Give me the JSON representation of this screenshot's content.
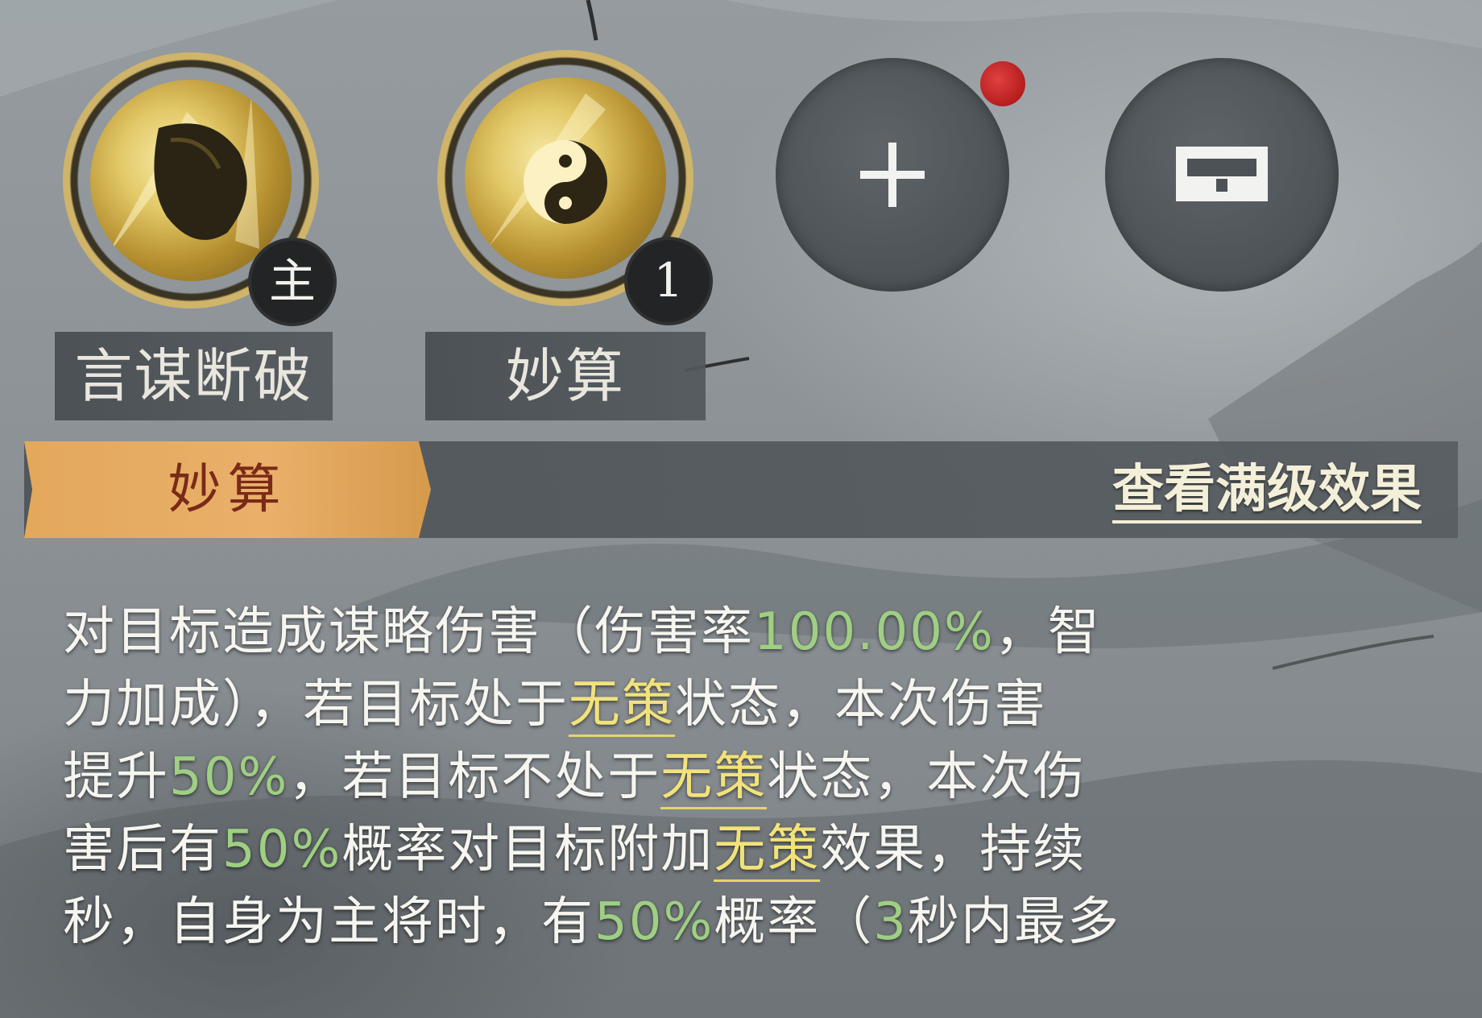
{
  "skills": {
    "slot_main": {
      "name": "言谋断破",
      "badge": "主",
      "icon": "leaf-emblem-icon"
    },
    "slot_1": {
      "name": "妙算",
      "badge": "1",
      "icon": "yin-yang-emblem-icon"
    },
    "slot_add": {
      "icon": "plus-icon",
      "has_notification": true
    },
    "slot_save": {
      "icon": "save-tray-icon"
    }
  },
  "tabbar": {
    "active_tab": "妙算",
    "link_label": "查看满级效果"
  },
  "description": {
    "lines": [
      [
        {
          "t": "对目标造成谋略伤害（伤害率",
          "k": "text"
        },
        {
          "t": "100.00%",
          "k": "num"
        },
        {
          "t": "，智",
          "k": "text"
        }
      ],
      [
        {
          "t": "力加成），若目标处于",
          "k": "text"
        },
        {
          "t": "无策",
          "k": "kw"
        },
        {
          "t": "状态，本次伤害",
          "k": "text"
        }
      ],
      [
        {
          "t": "提升",
          "k": "text"
        },
        {
          "t": "50%",
          "k": "num"
        },
        {
          "t": "，若目标不处于",
          "k": "text"
        },
        {
          "t": "无策",
          "k": "kw"
        },
        {
          "t": "状态，本次伤",
          "k": "text"
        }
      ],
      [
        {
          "t": "害后有",
          "k": "text"
        },
        {
          "t": "50%",
          "k": "num"
        },
        {
          "t": "概率对目标附加",
          "k": "text"
        },
        {
          "t": "无策",
          "k": "kw"
        },
        {
          "t": "效果，持续",
          "k": "text"
        }
      ],
      [
        {
          "t": "秒，自身为主将时，有",
          "k": "text"
        },
        {
          "t": "50%",
          "k": "num"
        },
        {
          "t": "概率（",
          "k": "text"
        },
        {
          "t": "3",
          "k": "num"
        },
        {
          "t": "秒内最多",
          "k": "text"
        }
      ]
    ]
  },
  "colors": {
    "tab_active": "#e3a85c",
    "tab_text": "#7a2a18",
    "number_green": "#9fcf82",
    "keyword_yellow": "#f2e27a",
    "notification_red": "#c92424"
  }
}
